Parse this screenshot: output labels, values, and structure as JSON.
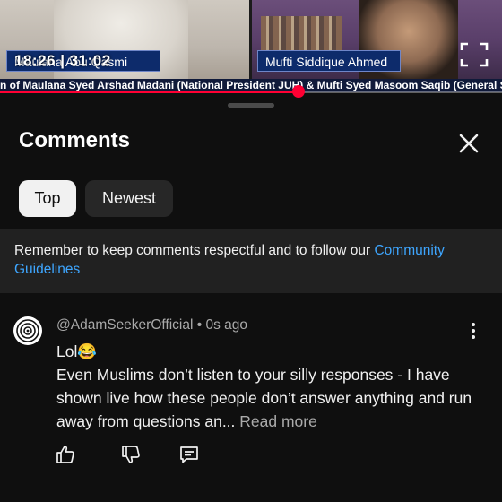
{
  "video": {
    "timestamp": "18:26 | 31:02",
    "left_name_tag": "Maulana Abu Qasmi",
    "right_name_tag": "Mufti Siddique Ahmed",
    "ticker": "n of Maulana Syed Arshad Madani (National President JUH) & Mufti Syed Masoom Saqib (General Secretary",
    "progress_fraction": 0.594
  },
  "comments_panel": {
    "title": "Comments",
    "close_icon": "close-icon",
    "tabs": [
      {
        "label": "Top",
        "selected": true
      },
      {
        "label": "Newest",
        "selected": false
      }
    ],
    "notice_text": "Remember to keep comments respectful and to follow our ",
    "notice_link": "Community Guidelines"
  },
  "comment": {
    "author": "@AdamSeekerOfficial",
    "separator": "•",
    "time": "0s ago",
    "line1": "Lol😂",
    "text": "Even Muslims don’t listen to your silly responses - I have shown live how these people don’t answer anything and run away from questions an...",
    "read_more": "Read more",
    "icons": [
      "thumbs-up-icon",
      "thumbs-down-icon",
      "reply-icon",
      "more-vert-icon"
    ]
  },
  "colors": {
    "background": "#0f0f0f",
    "progress": "#ff0033",
    "link": "#3ea6ff"
  }
}
